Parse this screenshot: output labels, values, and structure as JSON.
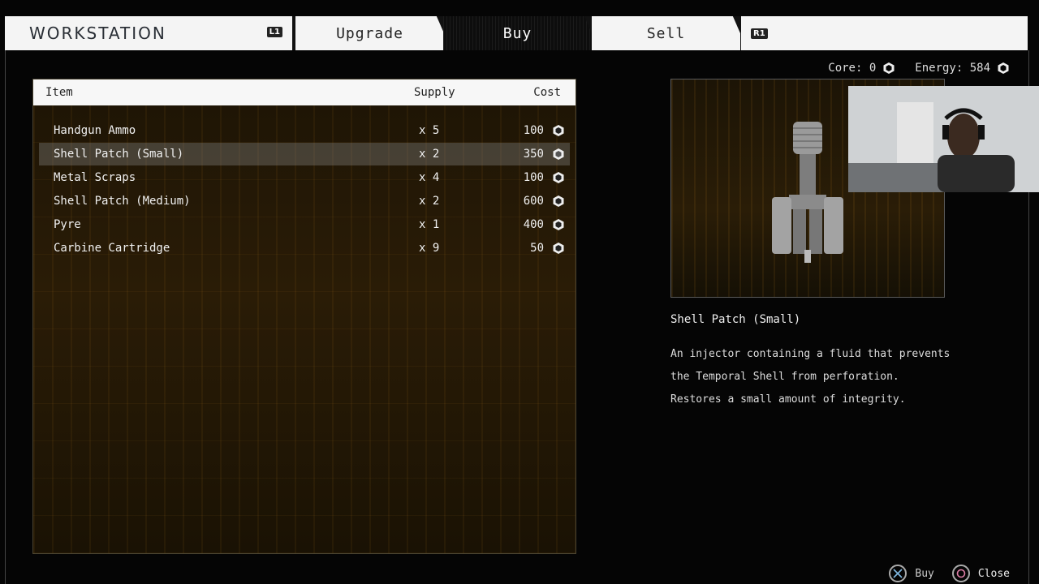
{
  "header": {
    "title": "WORKSTATION",
    "left_bumper": "L1",
    "right_bumper": "R1",
    "tabs": [
      {
        "label": "Upgrade",
        "active": false
      },
      {
        "label": "Buy",
        "active": true
      },
      {
        "label": "Sell",
        "active": false
      }
    ]
  },
  "currency": {
    "core_label": "Core: 0",
    "energy_label": "Energy: 584",
    "icon": "hex-currency-icon"
  },
  "list": {
    "columns": [
      "Item",
      "Supply",
      "Cost"
    ],
    "items": [
      {
        "name": "Handgun Ammo",
        "supply": "x 5",
        "cost": "100"
      },
      {
        "name": "Shell Patch (Small)",
        "supply": "x 2",
        "cost": "350",
        "selected": true
      },
      {
        "name": "Metal Scraps",
        "supply": "x 4",
        "cost": "100"
      },
      {
        "name": "Shell Patch (Medium)",
        "supply": "x 2",
        "cost": "600"
      },
      {
        "name": "Pyre",
        "supply": "x 1",
        "cost": "400"
      },
      {
        "name": "Carbine Cartridge",
        "supply": "x 9",
        "cost": "50"
      }
    ]
  },
  "details": {
    "title": "Shell Patch (Small)",
    "description": "An injector containing a fluid that prevents the Temporal Shell from perforation. Restores a small amount of integrity."
  },
  "footer": {
    "buy_label": "Buy",
    "close_label": "Close"
  },
  "colors": {
    "accent_panel": "#2a1c06",
    "tab_bg": "#f4f4f4",
    "active_tab_bg": "#0d0d0d"
  }
}
